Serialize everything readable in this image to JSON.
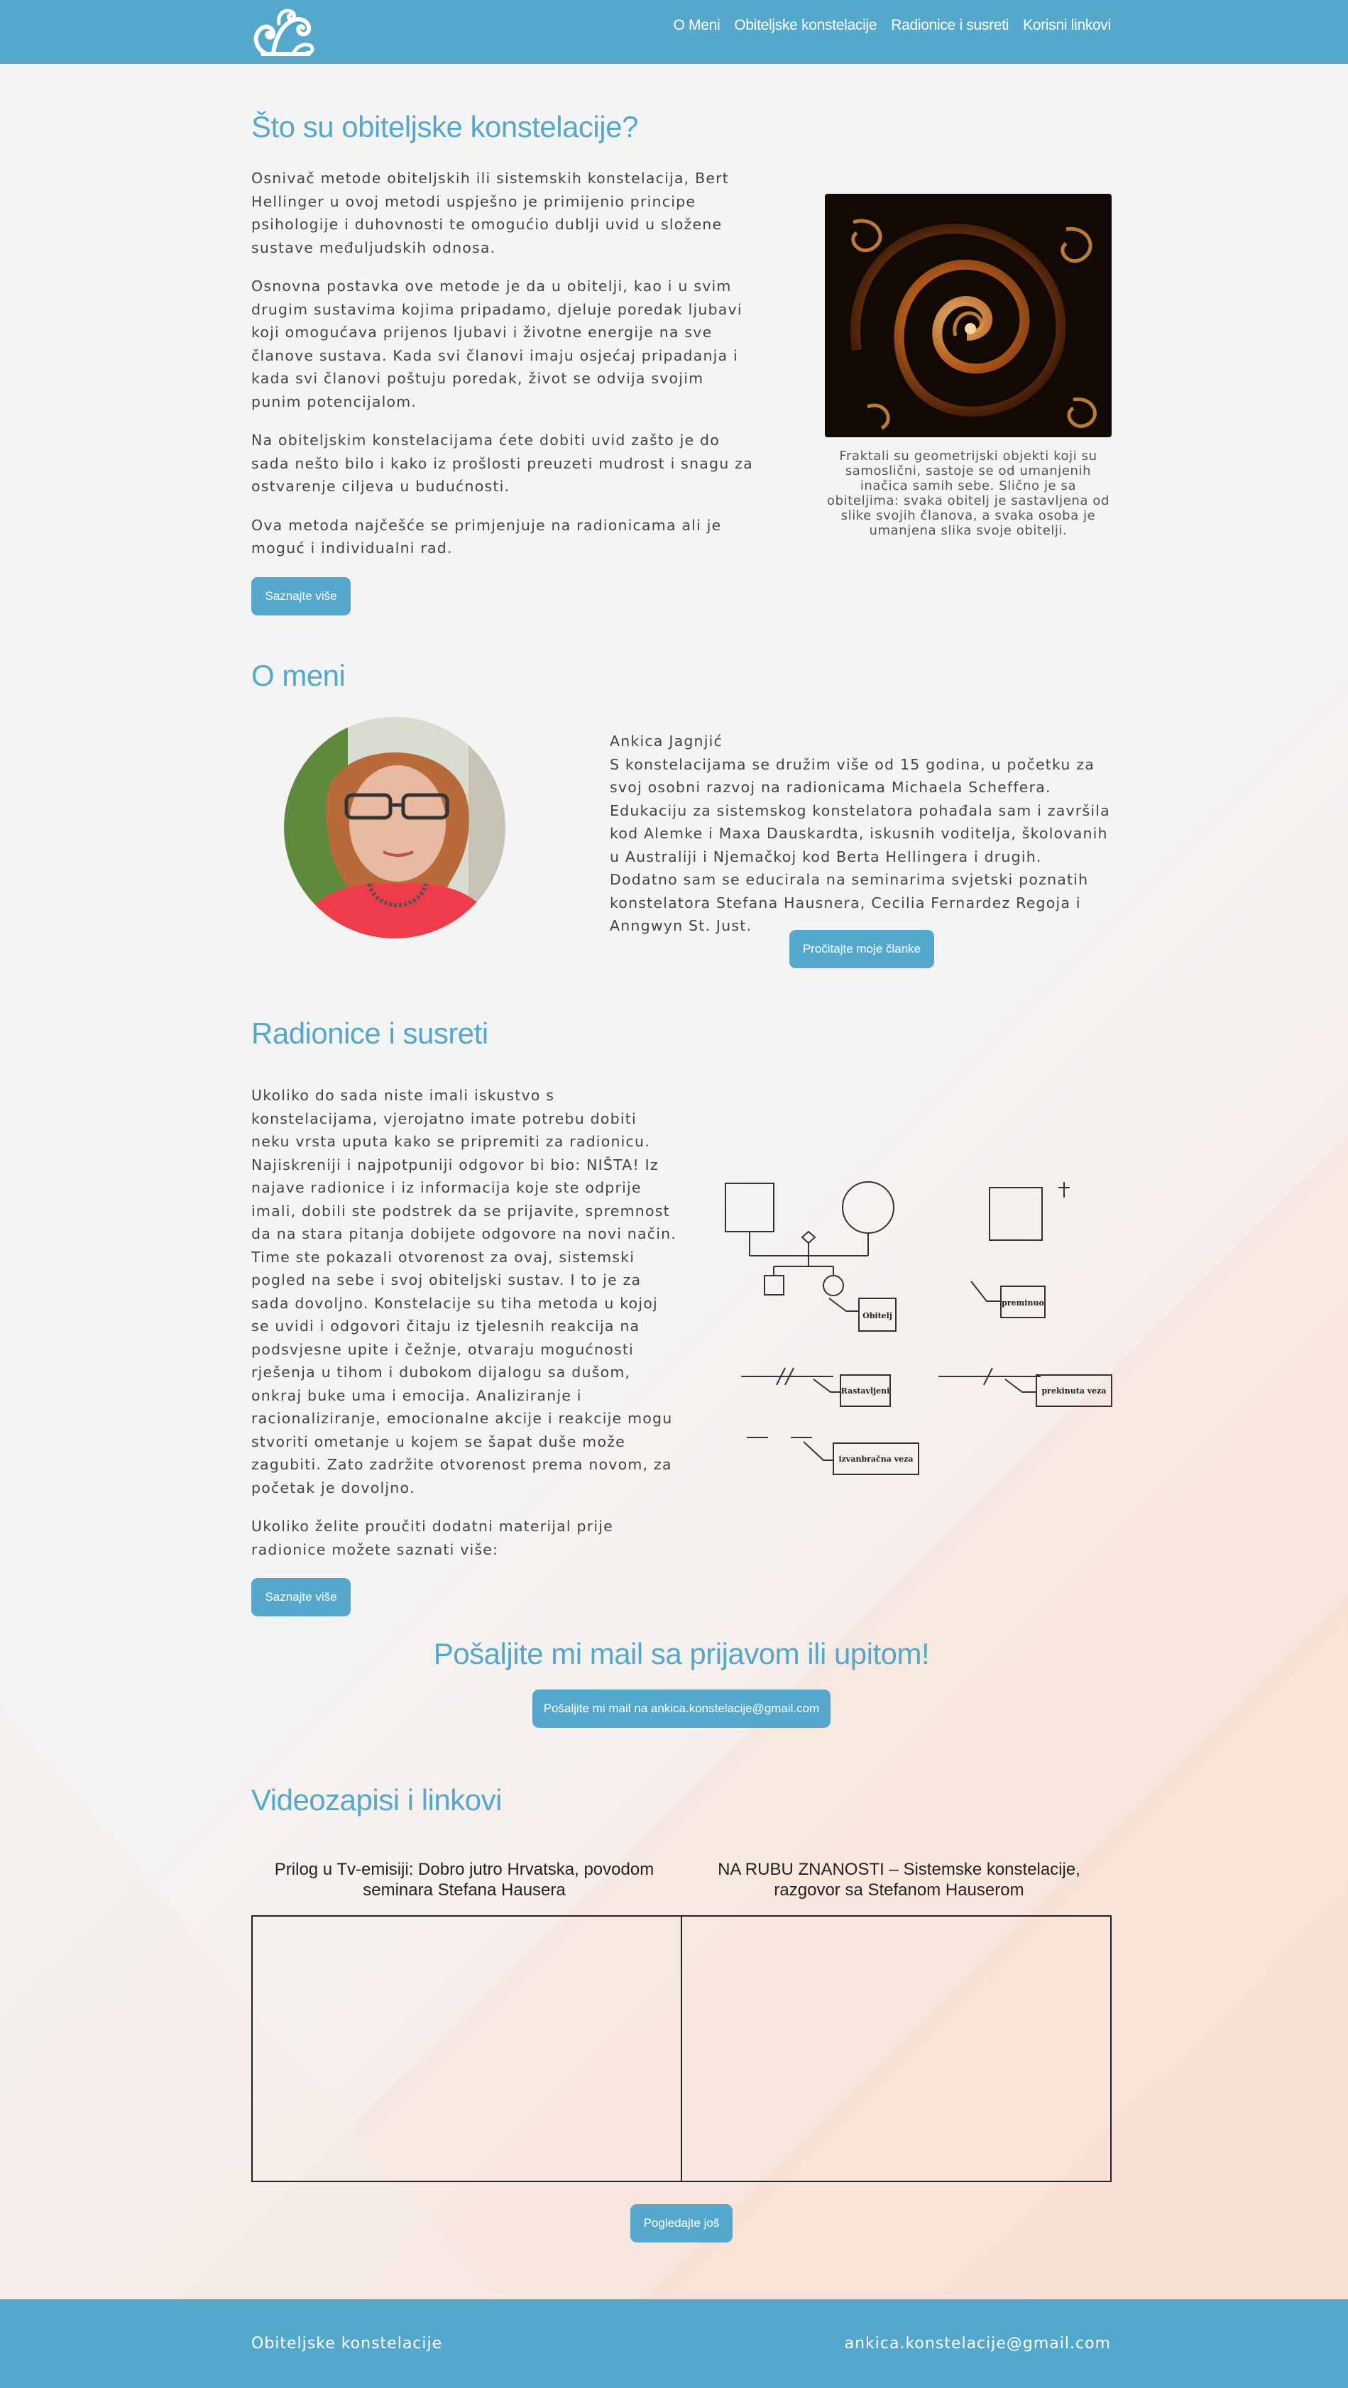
{
  "nav": {
    "items": [
      "O Meni",
      "Obiteljske konstelacije",
      "Radionice i susreti",
      "Korisni linkovi"
    ]
  },
  "intro": {
    "title": "Što su obiteljske konstelacije?",
    "paragraphs": [
      "Osnivač metode obiteljskih ili sistemskih konstelacija, Bert Hellinger u ovoj metodi uspješno je primijenio principe psihologije i duhovnosti te omogućio dublji uvid u složene sustave međuljudskih odnosa.",
      "Osnovna postavka ove metode je da u obitelji, kao i u svim drugim sustavima kojima pripadamo, djeluje poredak ljubavi koji omogućava prijenos ljubavi i životne energije na sve članove sustava. Kada svi članovi imaju osjećaj pripadanja i kada svi članovi poštuju poredak, život se odvija svojim punim potencijalom.",
      "Na obiteljskim konstelacijama ćete dobiti uvid zašto je do sada nešto bilo i kako iz prošlosti preuzeti mudrost i snagu za ostvarenje ciljeva u budućnosti.",
      "Ova metoda najčešće se primjenjuje na radionicama ali je moguć i individualni rad."
    ],
    "button": "Saznajte više",
    "image_caption": "Fraktali su geometrijski objekti koji su samoslični, sastoje se od umanjenih inačica samih sebe. Slično je sa obiteljima: svaka obitelj je sastavljena od slike svojih članova, a svaka osoba je umanjena slika svoje obitelji."
  },
  "about": {
    "title": "O meni",
    "name": "Ankica Jagnjić",
    "text": "S konstelacijama se družim više od 15 godina, u početku za svoj osobni razvoj na radionicama Michaela Scheffera. Edukaciju za sistemskog konstelatora pohađala sam i završila kod Alemke i Maxa Dauskardta, iskusnih voditelja, školovanih u Australiji i Njemačkoj kod Berta Hellingera i drugih. Dodatno sam se educirala na seminarima svjetski poznatih konstelatora Stefana Hausnera, Cecilia Fernardez Regoja i Anngwyn St. Just.",
    "button": "Pročitajte moje članke"
  },
  "workshops": {
    "title": "Radionice i susreti",
    "paragraph1": "Ukoliko do sada niste imali iskustvo s konstelacijama, vjerojatno imate potrebu dobiti neku vrsta uputa kako se pripremiti za radionicu. Najiskreniji i najpotpuniji odgovor bi bio: NIŠTA! Iz najave radionice i iz informacija koje ste odprije imali, dobili ste podstrek da se prijavite, spremnost da na stara pitanja dobijete odgovore na novi način. Time ste pokazali otvorenost za ovaj, sistemski pogled na sebe i svoj obiteljski sustav. I to je za sada dovoljno. Konstelacije su tiha metoda u kojoj se uvidi i odgovori čitaju iz tjelesnih reakcija na podsvjesne upite i čežnje, otvaraju mogućnosti rješenja u tihom i dubokom dijalogu sa dušom, onkraj buke uma i emocija. Analiziranje i racionaliziranje, emocionalne akcije i reakcije mogu stvoriti ometanje u kojem se šapat duše može zagubiti. Zato zadržite otvorenost prema novom, za početak je dovoljno.",
    "paragraph2": "Ukoliko želite proučiti dodatni materijal prije radionice možete saznati više:",
    "button": "Saznajte više",
    "diagram_labels": [
      "Obitelj",
      "preminuo",
      "Rastavljeni",
      "prekinuta veza",
      "izvanbračna veza"
    ],
    "diagram_cross": "†"
  },
  "contact": {
    "title": "Pošaljite mi mail sa prijavom ili upitom!",
    "button": "Pošaljite mi mail na ankica.konstelacije@gmail.com"
  },
  "videos": {
    "title": "Videozapisi i linkovi",
    "items": [
      "Prilog u Tv-emisiji: Dobro jutro Hrvatska, povodom seminara Stefana Hausera",
      "NA RUBU ZNANOSTI – Sistemske konstelacije, razgovor sa Stefanom Hauserom"
    ],
    "button": "Pogledajte još"
  },
  "footer": {
    "left": "Obiteljske konstelacije",
    "right": "ankica.konstelacije@gmail.com"
  },
  "colors": {
    "accent": "#55a8cb"
  }
}
